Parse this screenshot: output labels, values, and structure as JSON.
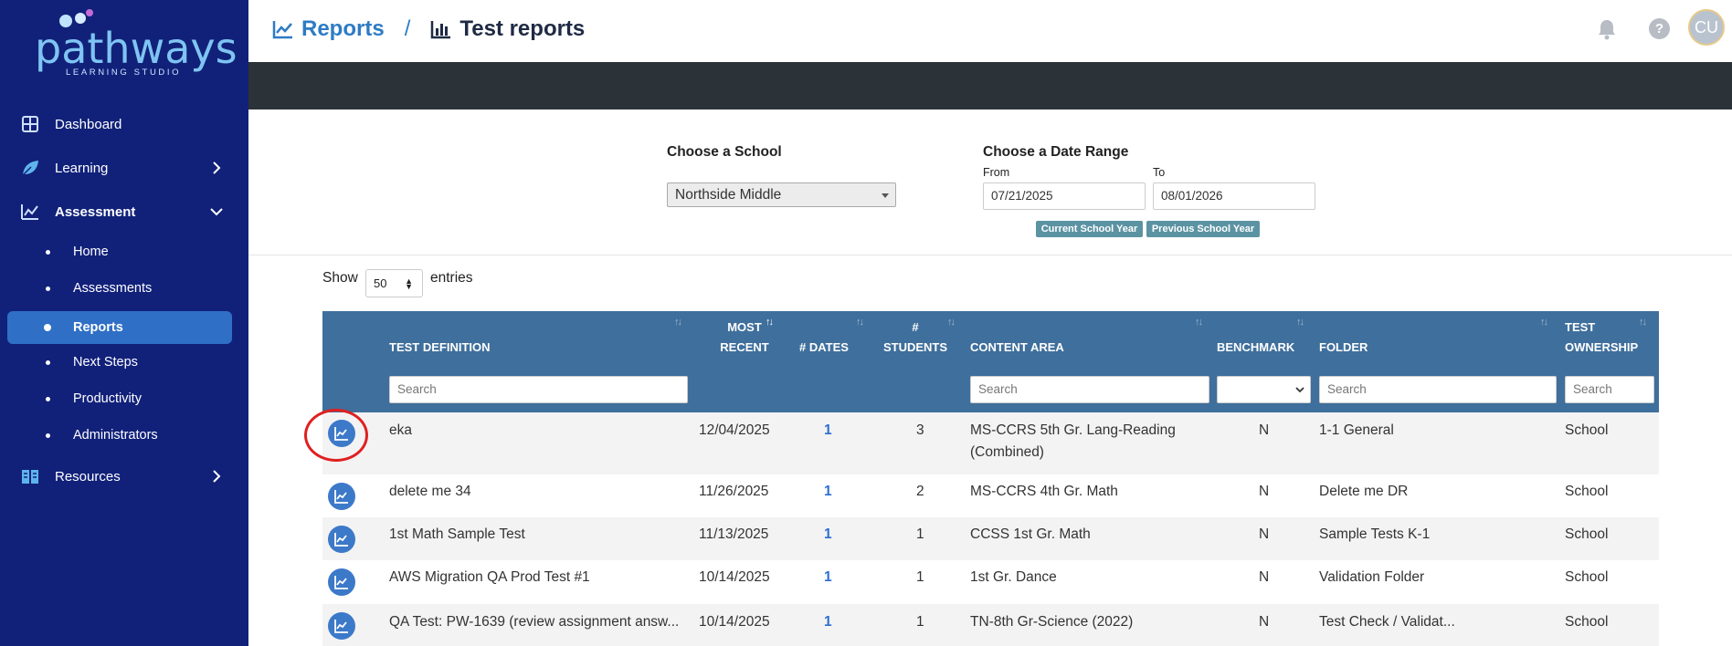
{
  "brand": {
    "logo_text": "pathways",
    "logo_sub": "LEARNING STUDIO"
  },
  "sidebar": {
    "items": [
      {
        "label": "Dashboard",
        "icon": "dashboard-icon"
      },
      {
        "label": "Learning",
        "icon": "leaf-icon"
      },
      {
        "label": "Assessment",
        "icon": "chart-icon"
      },
      {
        "label": "Resources",
        "icon": "book-icon"
      }
    ],
    "sub_items": [
      {
        "label": "Home"
      },
      {
        "label": "Assessments"
      },
      {
        "label": "Reports",
        "active": true
      },
      {
        "label": "Next Steps"
      },
      {
        "label": "Productivity"
      },
      {
        "label": "Administrators"
      }
    ]
  },
  "header": {
    "breadcrumb_parent": "Reports",
    "breadcrumb_separator": "/",
    "breadcrumb_current": "Test reports",
    "help_label": "?",
    "avatar_initials": "CU"
  },
  "filters": {
    "school_label": "Choose a School",
    "school_value": "Northside Middle",
    "date_label": "Choose a Date Range",
    "from_label": "From",
    "from_value": "07/21/2025",
    "to_label": "To",
    "to_value": "08/01/2026",
    "current_year_btn": "Current School Year",
    "previous_year_btn": "Previous School Year"
  },
  "entries": {
    "show_label": "Show",
    "value": "50",
    "entries_label": "entries"
  },
  "table": {
    "columns": {
      "test_definition": "TEST DEFINITION",
      "most_recent_1": "MOST",
      "most_recent_2": "RECENT",
      "dates": "# DATES",
      "students_1": "#",
      "students_2": "STUDENTS",
      "content_area": "CONTENT AREA",
      "benchmark": "BENCHMARK",
      "folder": "FOLDER",
      "ownership_1": "TEST",
      "ownership_2": "OWNERSHIP"
    },
    "search_placeholder": "Search",
    "rows": [
      {
        "name": "eka",
        "recent": "12/04/2025",
        "dates": "1",
        "students": "3",
        "content_1": "MS-CCRS 5th Gr. Lang-Reading",
        "content_2": "(Combined)",
        "benchmark": "N",
        "folder": "1-1 General",
        "ownership": "School"
      },
      {
        "name": "delete me 34",
        "recent": "11/26/2025",
        "dates": "1",
        "students": "2",
        "content_1": "MS-CCRS 4th Gr. Math",
        "content_2": "",
        "benchmark": "N",
        "folder": "Delete me DR",
        "ownership": "School"
      },
      {
        "name": "1st Math Sample Test",
        "recent": "11/13/2025",
        "dates": "1",
        "students": "1",
        "content_1": "CCSS 1st Gr. Math",
        "content_2": "",
        "benchmark": "N",
        "folder": "Sample Tests K-1",
        "ownership": "School"
      },
      {
        "name": "AWS Migration QA Prod Test #1",
        "recent": "10/14/2025",
        "dates": "1",
        "students": "1",
        "content_1": "1st Gr. Dance",
        "content_2": "",
        "benchmark": "N",
        "folder": "Validation Folder",
        "ownership": "School"
      },
      {
        "name": "QA Test: PW-1639 (review assignment answ...",
        "recent": "10/14/2025",
        "dates": "1",
        "students": "1",
        "content_1": "TN-8th Gr-Science (2022)",
        "content_2": "",
        "benchmark": "N",
        "folder": "Test Check / Validat...",
        "ownership": "School"
      }
    ]
  },
  "colors": {
    "sidebar": "#11217a",
    "active": "#2f6fc6",
    "table_header": "#3f6f9c",
    "highlight": "#e02020"
  }
}
